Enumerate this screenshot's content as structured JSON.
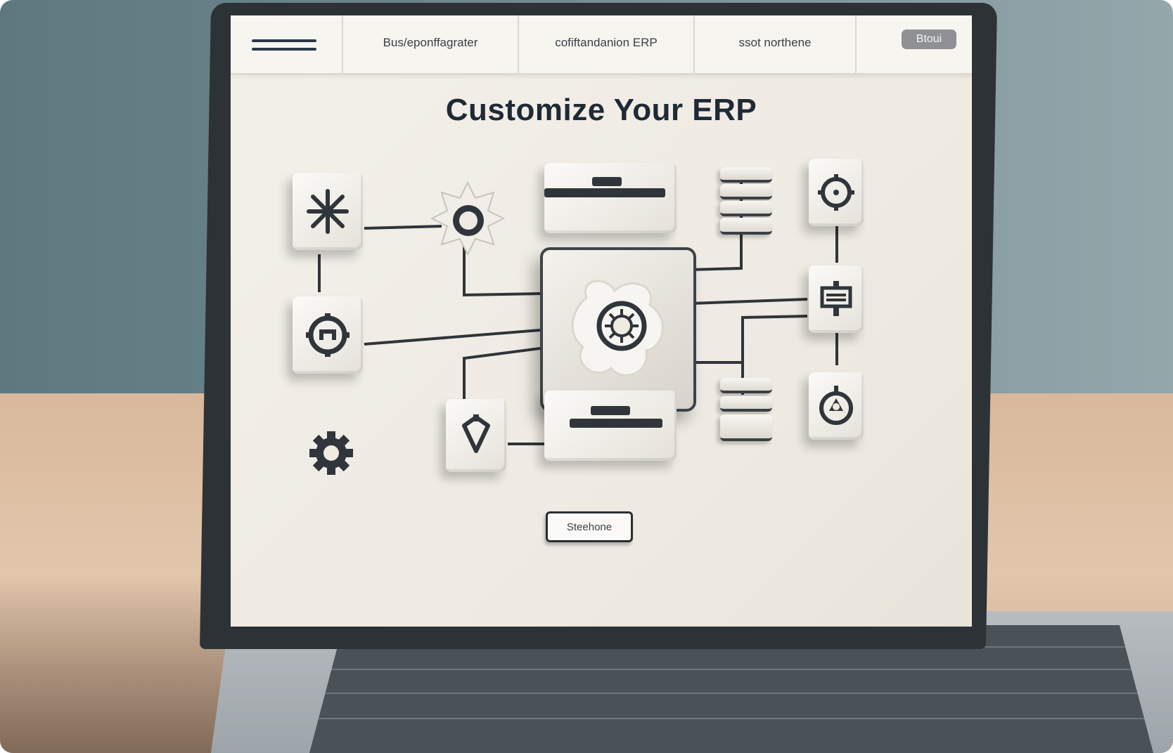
{
  "nav": {
    "items": [
      "Bus/eponffagrater",
      "cofiftandanion ERP",
      "ssot northene"
    ],
    "button_label": "Btoui"
  },
  "page": {
    "title": "Customize Your ERP",
    "cta_label": "Steehone"
  },
  "diagram": {
    "nodes": [
      {
        "name": "asterisk-tool-icon"
      },
      {
        "name": "gear-outline-icon"
      },
      {
        "name": "target-icon"
      },
      {
        "name": "gear-icon"
      },
      {
        "name": "shield-icon"
      },
      {
        "name": "settings-circle-icon"
      },
      {
        "name": "display-board-icon"
      },
      {
        "name": "aperture-icon"
      },
      {
        "name": "core-module-icon"
      }
    ]
  },
  "colors": {
    "screen_bg": "#f0ede6",
    "ink": "#2f353a",
    "title": "#1f2a36",
    "nav_button": "#8e9093"
  }
}
